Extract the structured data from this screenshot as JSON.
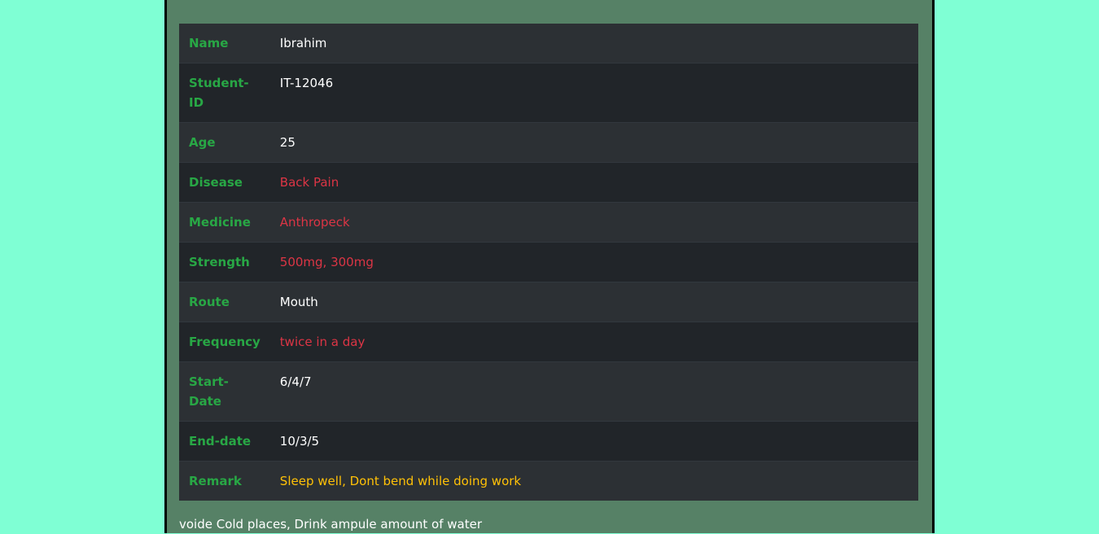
{
  "rows": [
    {
      "label": "Name",
      "value": "Ibrahim"
    },
    {
      "label": "Student-ID",
      "value": "IT-12046"
    },
    {
      "label": "Age",
      "value": "25"
    },
    {
      "label": "Disease",
      "value": "Back Pain"
    },
    {
      "label": "Medicine",
      "value": "Anthropeck"
    },
    {
      "label": "Strength",
      "value": "500mg, 300mg"
    },
    {
      "label": "Route",
      "value": "Mouth"
    },
    {
      "label": "Frequency",
      "value": "twice in a day"
    },
    {
      "label": "Start-Date",
      "value": "6/4/7"
    },
    {
      "label": "End-date",
      "value": "10/3/5"
    },
    {
      "label": "Remark",
      "value": "Sleep well, Dont bend while doing work"
    }
  ],
  "footnote": "voide Cold places, Drink ampule amount of water",
  "colors": {
    "page_bg": "#7fffd4",
    "panel_bg": "#568166",
    "label": "#28a745",
    "danger": "#dc3545",
    "warning": "#ffc107"
  }
}
